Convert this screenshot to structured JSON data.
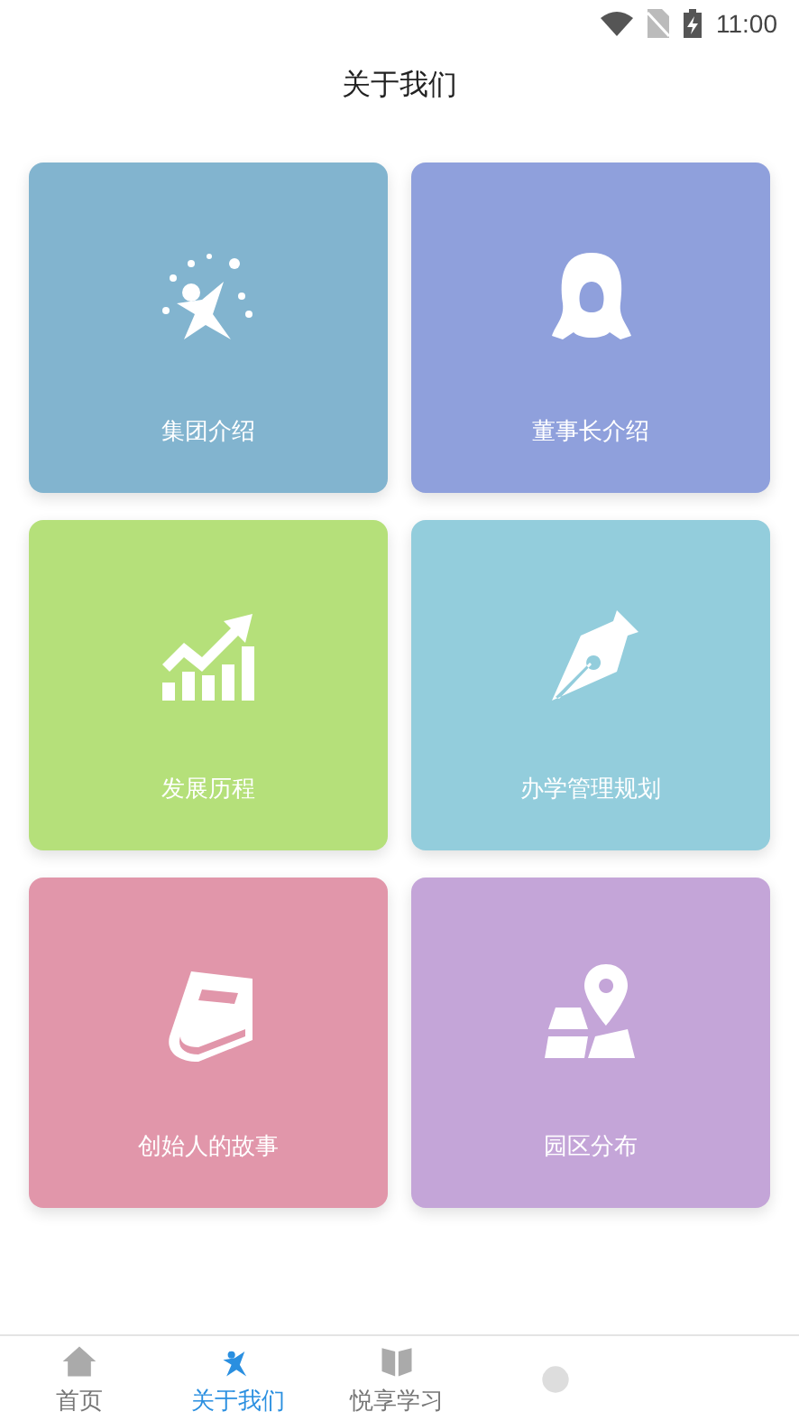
{
  "status_bar": {
    "time": "11:00"
  },
  "header": {
    "title": "关于我们"
  },
  "cards": [
    {
      "kind": "stars",
      "label": "集团介绍",
      "color": "#82b4cf"
    },
    {
      "kind": "person",
      "label": "董事长介绍",
      "color": "#8fa0dc"
    },
    {
      "kind": "growth",
      "label": "发展历程",
      "color": "#b5e07a"
    },
    {
      "kind": "pen",
      "label": "办学管理规划",
      "color": "#93cddc"
    },
    {
      "kind": "book",
      "label": "创始人的故事",
      "color": "#e196aa"
    },
    {
      "kind": "map",
      "label": "园区分布",
      "color": "#c4a5d8"
    }
  ],
  "tab_bar": [
    {
      "kind": "home",
      "label": "首页",
      "selected": false
    },
    {
      "kind": "stars",
      "label": "关于我们",
      "selected": true
    },
    {
      "kind": "book",
      "label": "悦享学习",
      "selected": false
    },
    {
      "kind": "other",
      "selected": false
    }
  ]
}
